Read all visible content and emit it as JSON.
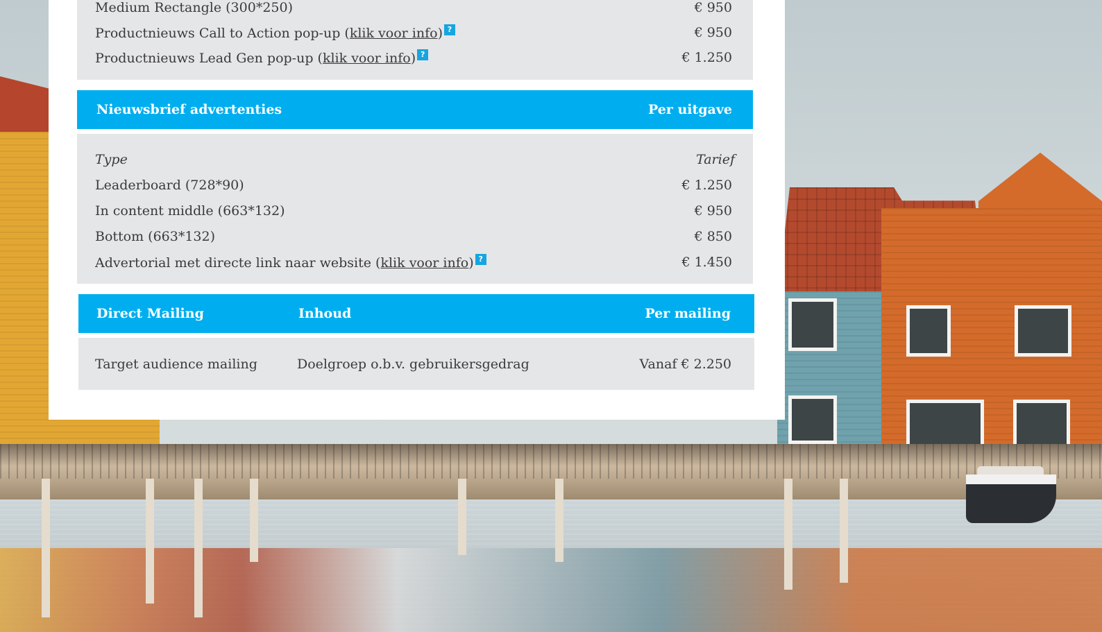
{
  "top_section": {
    "rows": [
      {
        "label": "Medium Rectangle (300*250)",
        "link": "",
        "price": "€ 950"
      },
      {
        "label": "Productnieuws Call to Action pop-up (",
        "link": "klik voor info",
        "suffix": ")",
        "price": "€ 950"
      },
      {
        "label": "Productnieuws Lead Gen pop-up (",
        "link": "klik voor info",
        "suffix": ")",
        "price": "€ 1.250"
      }
    ]
  },
  "newsletter": {
    "header_title": "Nieuwsbrief advertenties",
    "header_right": "Per uitgave",
    "col_type": "Type",
    "col_rate": "Tarief",
    "rows": [
      {
        "label": "Leaderboard (728*90)",
        "price": "€ 1.250"
      },
      {
        "label": "In content middle (663*132)",
        "price": "€ 950"
      },
      {
        "label": "Bottom (663*132)",
        "price": "€ 850"
      },
      {
        "label": "Advertorial met directe link naar website (",
        "link": "klik voor info",
        "suffix": ")",
        "price": "€ 1.450"
      }
    ]
  },
  "direct_mailing": {
    "header_title": "Direct Mailing",
    "header_middle": "Inhoud",
    "header_right": "Per mailing",
    "row": {
      "name": "Target audience mailing",
      "content": "Doelgroep o.b.v. gebruikersgedrag",
      "price": "Vanaf € 2.250"
    }
  },
  "icons": {
    "help": "question-mark-icon",
    "help_glyph": "?"
  },
  "colors": {
    "accent": "#00aeef",
    "table_bg": "#e5e6e7"
  }
}
